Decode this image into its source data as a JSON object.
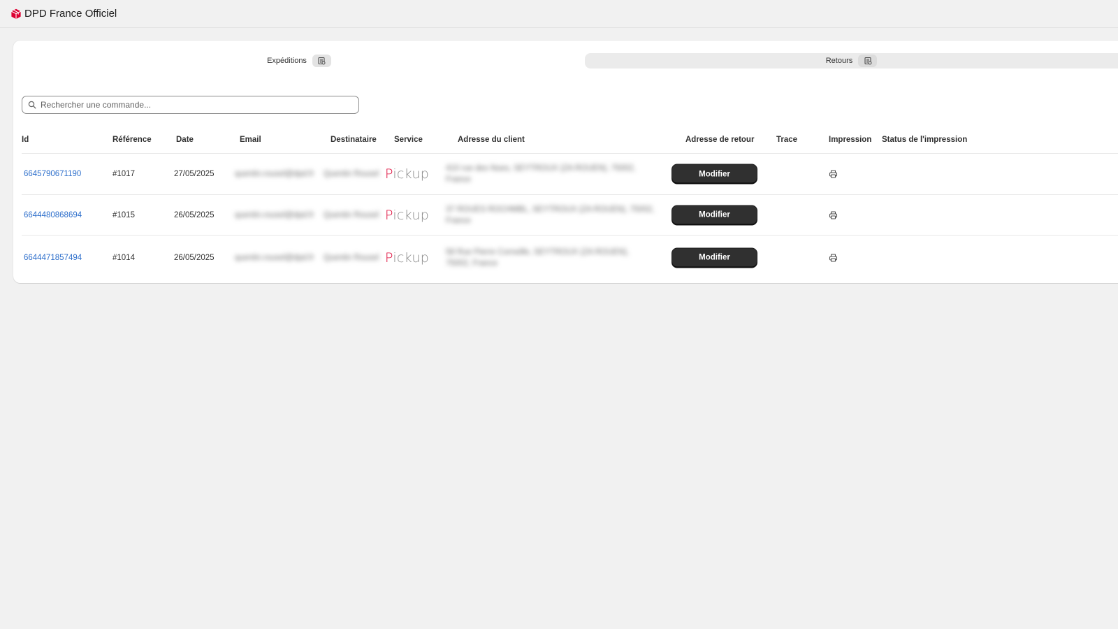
{
  "app": {
    "title": "DPD France Officiel",
    "brand_color": "#dc0032"
  },
  "tabs": [
    {
      "label": "Expéditions",
      "icon": "receipt-icon",
      "active": true
    },
    {
      "label": "Retours",
      "icon": "receipt-icon",
      "active": false
    }
  ],
  "search": {
    "placeholder": "Rechercher une commande...",
    "value": ""
  },
  "table": {
    "headers": [
      "Id",
      "Référence",
      "Date",
      "Email",
      "Destinataire",
      "Service",
      "Adresse du client",
      "Adresse de retour",
      "Trace",
      "Impression",
      "Status de l'impression"
    ],
    "rows": [
      {
        "id": "6645790671190",
        "reference": "#1017",
        "date": "27/05/2025",
        "email": "quentin.rousel@dpd.fr",
        "destinataire": "Quentin Rousel",
        "service": "Pickup",
        "adresse_client": "410 rue des Noes, SEYTROUX (ZA ROUEN), 75002, France",
        "action_label": "Modifier"
      },
      {
        "id": "6644480868694",
        "reference": "#1015",
        "date": "26/05/2025",
        "email": "quentin.rousel@dpd.fr",
        "destinataire": "Quentin Rousel",
        "service": "Pickup",
        "adresse_client": "37 ROUES ROCHMBL, SEYTROUX (ZA ROUEN), 75002, France",
        "action_label": "Modifier"
      },
      {
        "id": "6644471857494",
        "reference": "#1014",
        "date": "26/05/2025",
        "email": "quentin.rousel@dpd.fr",
        "destinataire": "Quentin Rousel",
        "service": "Pickup",
        "adresse_client": "58 Rue Pierre Corneille, SEYTROUX (ZA ROUEN), 75002, France",
        "action_label": "Modifier"
      }
    ]
  }
}
